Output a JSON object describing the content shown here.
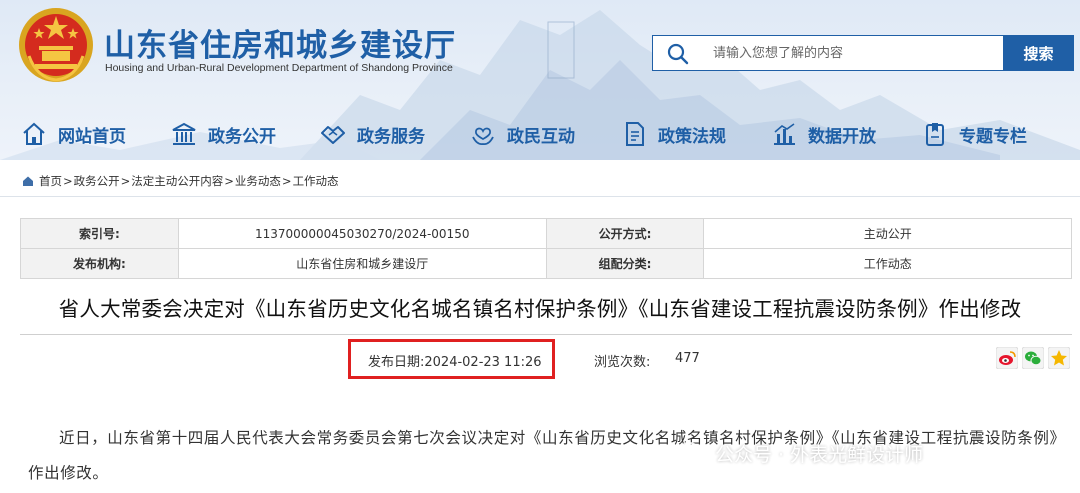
{
  "site": {
    "title": "山东省住房和城乡建设厅",
    "subtitle": "Housing and Urban-Rural Development Department of Shandong Province"
  },
  "search": {
    "placeholder": "请输入您想了解的内容",
    "button_label": "搜索"
  },
  "nav": {
    "items": [
      {
        "label": "网站首页",
        "icon": "home-icon"
      },
      {
        "label": "政务公开",
        "icon": "building-icon"
      },
      {
        "label": "政务服务",
        "icon": "handshake-icon"
      },
      {
        "label": "政民互动",
        "icon": "heart-hands-icon"
      },
      {
        "label": "政策法规",
        "icon": "document-icon"
      },
      {
        "label": "数据开放",
        "icon": "bar-chart-icon"
      },
      {
        "label": "专题专栏",
        "icon": "bookmark-icon"
      }
    ]
  },
  "breadcrumb": {
    "items": [
      "首页",
      "政务公开",
      "法定主动公开内容",
      "业务动态",
      "工作动态"
    ],
    "separator": ">"
  },
  "meta": {
    "rows": [
      {
        "k1": "索引号:",
        "v1": "113700000045030270/2024-00150",
        "k2": "公开方式:",
        "v2": "主动公开"
      },
      {
        "k1": "发布机构:",
        "v1": "山东省住房和城乡建设厅",
        "k2": "组配分类:",
        "v2": "工作动态"
      }
    ]
  },
  "article": {
    "title": "省人大常委会决定对《山东省历史文化名城名镇名村保护条例》《山东省建设工程抗震设防条例》作出修改",
    "publish_date": "发布日期:2024-02-23 11:26",
    "views_label": "浏览次数:",
    "views_count": "477",
    "body": "近日，山东省第十四届人民代表大会常务委员会第七次会议决定对《山东省历史文化名城名镇名村保护条例》《山东省建设工程抗震设防条例》作出修改。"
  },
  "share": {
    "icons": [
      "weibo-icon",
      "wechat-icon",
      "favorite-star-icon"
    ]
  },
  "watermark": {
    "text": "公众号 · 外表光鲜设计师"
  },
  "colors": {
    "brand_blue": "#1f5fa6",
    "highlight_red": "#e02020",
    "header_bg": "#e3ecf7",
    "table_key_bg": "#f2f2f2"
  }
}
